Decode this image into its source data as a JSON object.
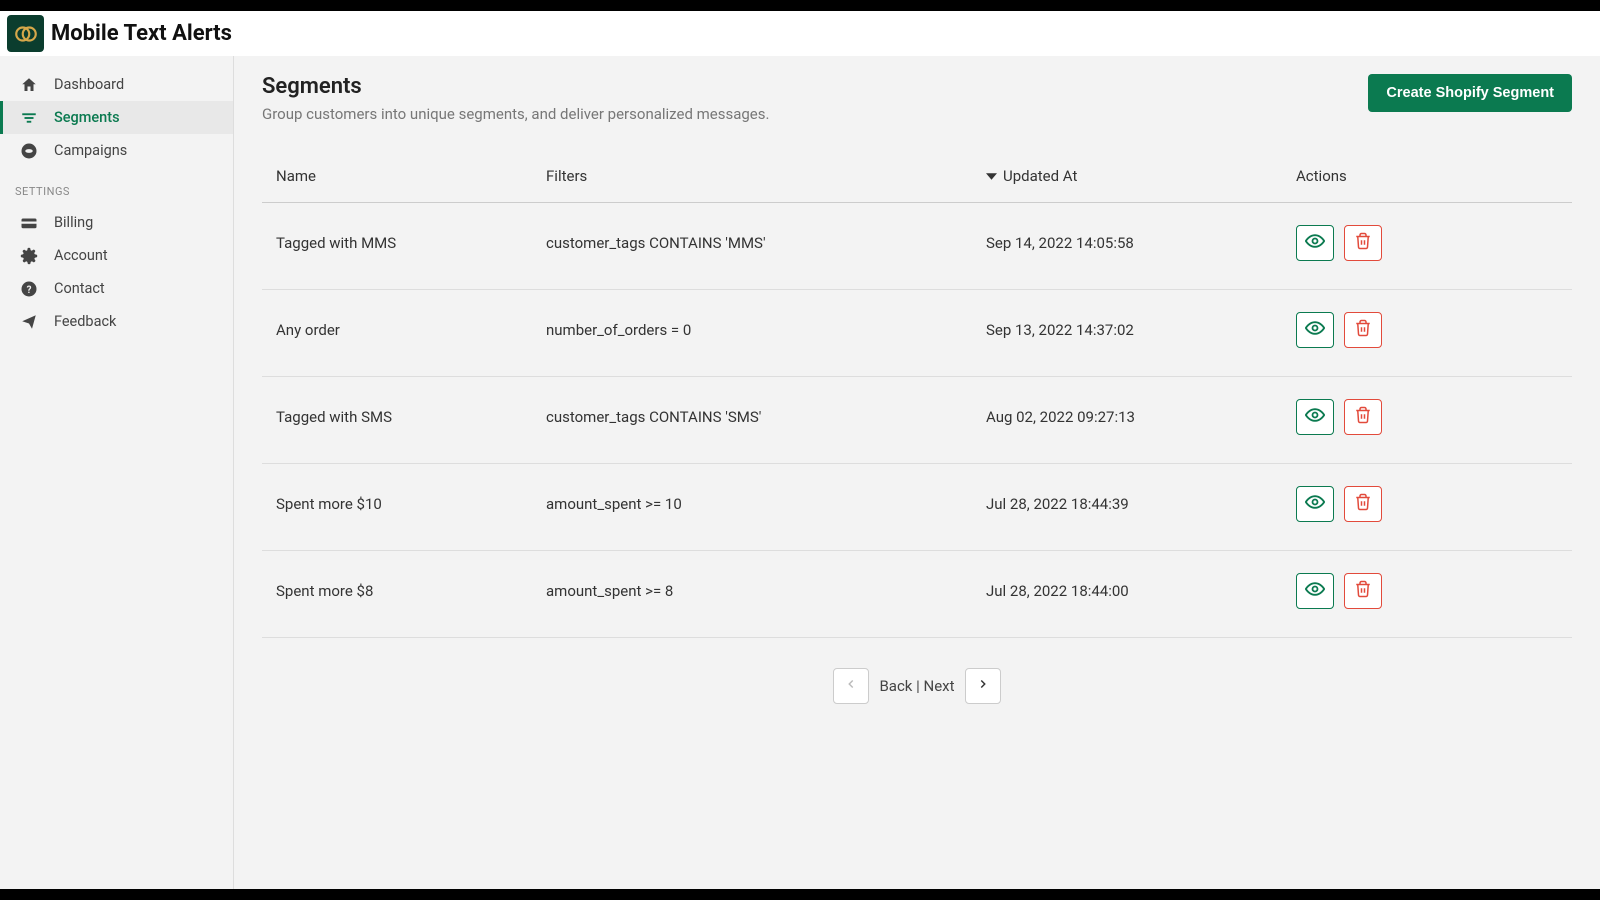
{
  "brand": "Mobile Text Alerts",
  "sidebar": {
    "items": [
      {
        "label": "Dashboard",
        "icon": "home-icon",
        "active": false
      },
      {
        "label": "Segments",
        "icon": "segments-icon",
        "active": true
      },
      {
        "label": "Campaigns",
        "icon": "campaigns-icon",
        "active": false
      }
    ],
    "settings_label": "SETTINGS",
    "settings_items": [
      {
        "label": "Billing",
        "icon": "billing-icon"
      },
      {
        "label": "Account",
        "icon": "account-icon"
      },
      {
        "label": "Contact",
        "icon": "contact-icon"
      },
      {
        "label": "Feedback",
        "icon": "feedback-icon"
      }
    ]
  },
  "page": {
    "title": "Segments",
    "subtitle": "Group customers into unique segments, and deliver personalized messages.",
    "create_button": "Create Shopify Segment"
  },
  "table": {
    "headers": {
      "name": "Name",
      "filters": "Filters",
      "updated_at": "Updated At",
      "actions": "Actions"
    },
    "rows": [
      {
        "name": "Tagged with MMS",
        "filters": "customer_tags CONTAINS 'MMS'",
        "updated_at": "Sep 14, 2022 14:05:58"
      },
      {
        "name": "Any order",
        "filters": "number_of_orders = 0",
        "updated_at": "Sep 13, 2022 14:37:02"
      },
      {
        "name": "Tagged with SMS",
        "filters": "customer_tags CONTAINS 'SMS'",
        "updated_at": "Aug 02, 2022 09:27:13"
      },
      {
        "name": "Spent more $10",
        "filters": "amount_spent >= 10",
        "updated_at": "Jul 28, 2022 18:44:39"
      },
      {
        "name": "Spent more $8",
        "filters": "amount_spent >= 8",
        "updated_at": "Jul 28, 2022 18:44:00"
      }
    ]
  },
  "pagination": {
    "label": "Back | Next"
  },
  "colors": {
    "accent": "#0b7a50",
    "danger": "#e24a3b"
  }
}
